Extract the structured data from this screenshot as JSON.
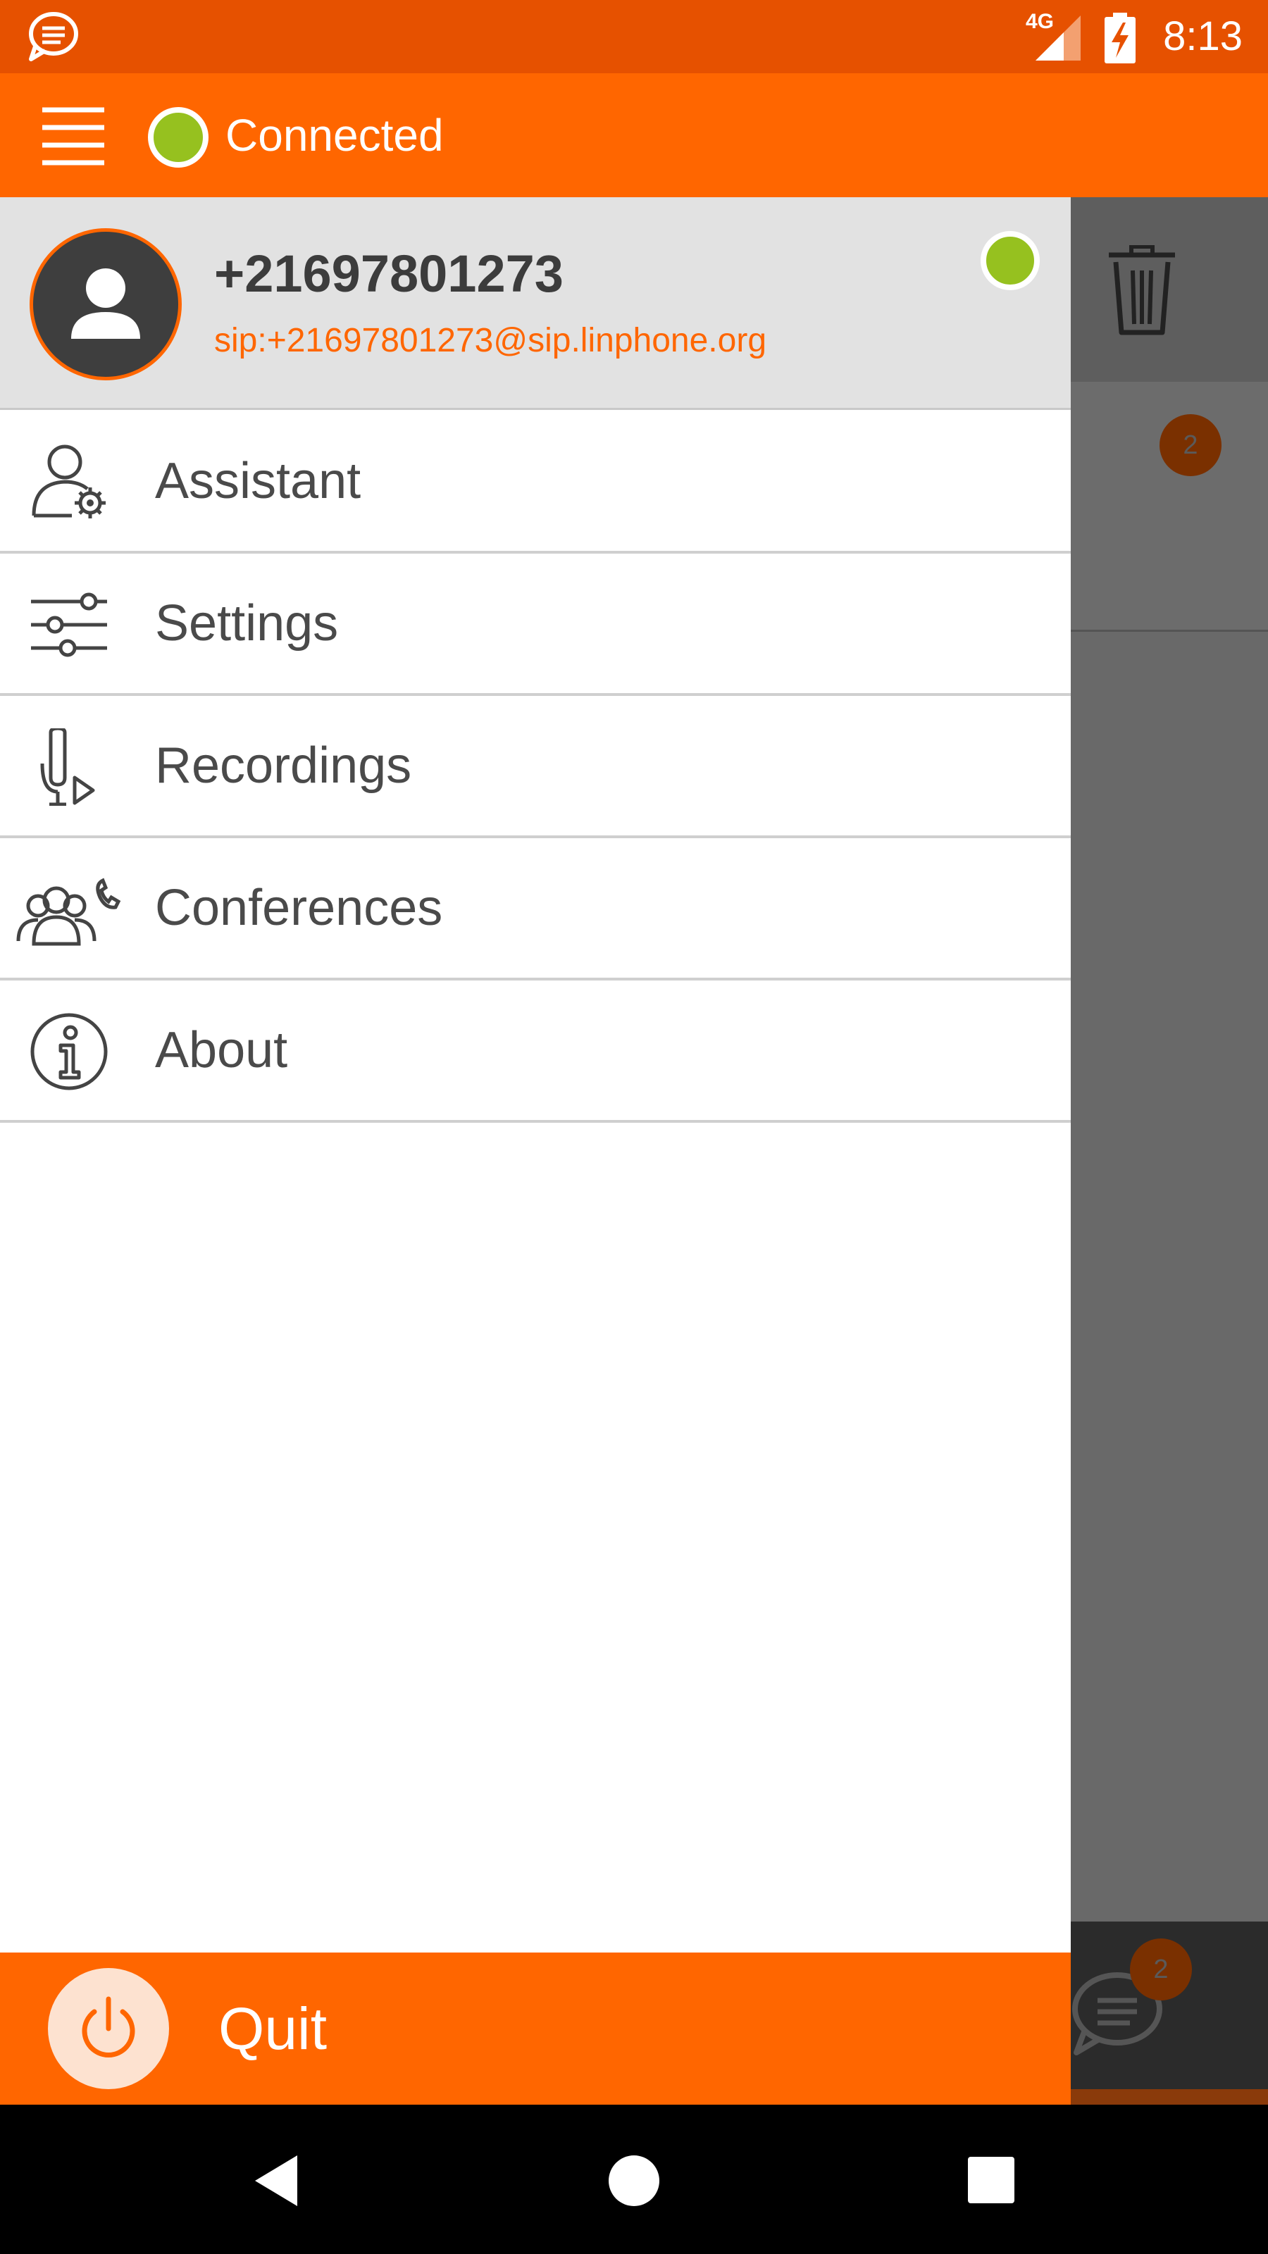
{
  "status_bar": {
    "network_label": "4G",
    "time": "8:13",
    "icons": [
      "chat-notification-icon",
      "signal-icon",
      "battery-charging-icon"
    ]
  },
  "app_bar": {
    "status_text": "Connected",
    "status_color": "#96C11F",
    "icons": [
      "menu-icon",
      "presence-dot-icon"
    ]
  },
  "account": {
    "display_name": "+21697801273",
    "sip_address": "sip:+21697801273@sip.linphone.org",
    "presence_color": "#96C11F"
  },
  "menu": {
    "items": [
      {
        "label": "Assistant",
        "icon": "assistant-icon"
      },
      {
        "label": "Settings",
        "icon": "settings-sliders-icon"
      },
      {
        "label": "Recordings",
        "icon": "recordings-icon"
      },
      {
        "label": "Conferences",
        "icon": "conferences-icon"
      },
      {
        "label": "About",
        "icon": "info-icon"
      }
    ]
  },
  "quit": {
    "label": "Quit",
    "icon": "power-icon"
  },
  "background": {
    "row_badge": "2",
    "chat_badge": "2",
    "icons": [
      "trash-icon",
      "chat-icon"
    ]
  },
  "colors": {
    "accent": "#FF6600",
    "status_bar": "#E65100",
    "presence": "#96C11F",
    "drawer_header": "#E2E2E2"
  }
}
